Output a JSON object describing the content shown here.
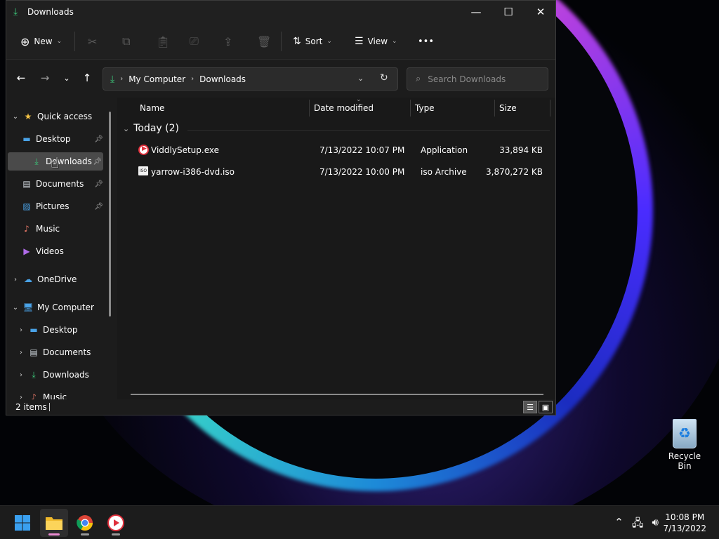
{
  "window": {
    "title": "Downloads"
  },
  "toolbar": {
    "new_label": "New",
    "sort_label": "Sort",
    "view_label": "View",
    "more_label": "•••"
  },
  "address": {
    "segments": [
      "My Computer",
      "Downloads"
    ]
  },
  "search": {
    "placeholder": "Search Downloads"
  },
  "nav": {
    "items": [
      {
        "label": "Quick access",
        "icon": "star-icon",
        "expanded": true
      },
      {
        "label": "Desktop",
        "icon": "desktop-icon",
        "pinned": true
      },
      {
        "label": "Downloads",
        "icon": "download-icon",
        "pinned": true,
        "selected": true
      },
      {
        "label": "Documents",
        "icon": "documents-icon",
        "pinned": true
      },
      {
        "label": "Pictures",
        "icon": "pictures-icon",
        "pinned": true
      },
      {
        "label": "Music",
        "icon": "music-icon"
      },
      {
        "label": "Videos",
        "icon": "videos-icon"
      },
      {
        "label": "OneDrive",
        "icon": "cloud-icon",
        "expanded": false
      },
      {
        "label": "My Computer",
        "icon": "computer-icon",
        "expanded": true
      },
      {
        "label": "Desktop",
        "icon": "desktop-icon",
        "expanded": false
      },
      {
        "label": "Documents",
        "icon": "documents-icon",
        "expanded": false
      },
      {
        "label": "Downloads",
        "icon": "download-icon",
        "expanded": false
      },
      {
        "label": "Music",
        "icon": "music-icon",
        "expanded": false
      }
    ]
  },
  "columns": {
    "name": "Name",
    "date": "Date modified",
    "type": "Type",
    "size": "Size"
  },
  "group": {
    "label": "Today (2)"
  },
  "files": [
    {
      "name": "ViddlySetup.exe",
      "date": "7/13/2022 10:07 PM",
      "type": "Application",
      "size": "33,894 KB",
      "icon": "viddly-app-icon"
    },
    {
      "name": "yarrow-i386-dvd.iso",
      "date": "7/13/2022 10:00 PM",
      "type": "iso Archive",
      "size": "3,870,272 KB",
      "icon": "iso-file-icon"
    }
  ],
  "status": {
    "item_count": "2 items"
  },
  "desktop": {
    "recycle_bin_label": "Recycle Bin"
  },
  "clock": {
    "time": "10:08 PM",
    "date": "7/13/2022"
  },
  "colors": {
    "accent": "#3cc77a",
    "selection": "#4a4a4a",
    "window_bg": "#1c1c1c"
  }
}
